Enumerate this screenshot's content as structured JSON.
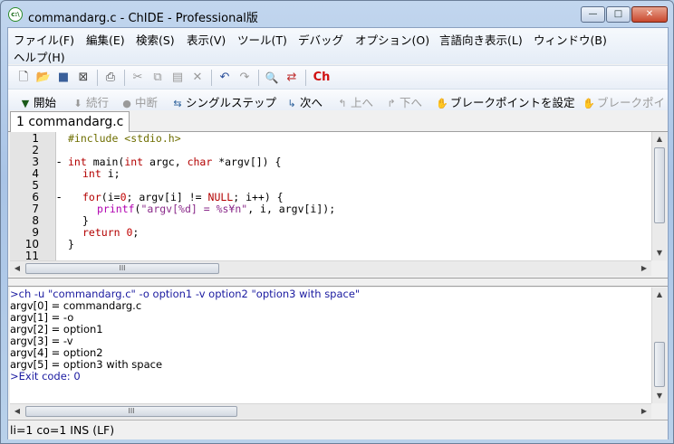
{
  "window": {
    "title": "commandarg.c - ChIDE - Professional版",
    "icon_label": "c:\\",
    "controls": {
      "minimize": "—",
      "maximize": "□",
      "close": "✕"
    }
  },
  "menu": [
    "ファイル(F)",
    "編集(E)",
    "検索(S)",
    "表示(V)",
    "ツール(T)",
    "デバッグ",
    "オプション(O)",
    "言語向き表示(L)",
    "ウィンドウ(B)",
    "ヘルプ(H)"
  ],
  "toolbar_icons": [
    "new-file-icon",
    "open-folder-icon",
    "save-icon",
    "close-file-icon",
    "print-icon",
    "cut-icon",
    "copy-icon",
    "paste-icon",
    "delete-icon",
    "undo-icon",
    "redo-icon",
    "find-icon",
    "replace-icon",
    "ch-run-icon"
  ],
  "toolbar_glyphs": {
    "new": "🗋",
    "open": "📂",
    "save": "■",
    "closefile": "⊠",
    "print": "⎙",
    "cut": "✂",
    "copy": "⧉",
    "paste": "▤",
    "delete": "✕",
    "undo": "↶",
    "redo": "↷",
    "find": "🔍",
    "replace": "⇄",
    "ch": "Ch"
  },
  "debug": {
    "start": "開始",
    "continue": "続行",
    "abort": "中断",
    "single_step": "シングルステップ",
    "next": "次へ",
    "up": "上へ",
    "down": "下へ",
    "breakpoint": "ブレークポイントを設定",
    "breakpoint2": "ブレークポイ"
  },
  "tab": {
    "label": "1 commandarg.c"
  },
  "editor": {
    "line_numbers": [
      "1",
      "2",
      "3",
      "4",
      "5",
      "6",
      "7",
      "8",
      "9",
      "10",
      "11"
    ],
    "lines": {
      "l1_pp": "#include <stdio.h>",
      "l3_kw1": "int",
      "l3_a": " main(",
      "l3_kw2": "int",
      "l3_b": " argc, ",
      "l3_kw3": "char",
      "l3_c": " *argv[]) {",
      "l4_kw": "int",
      "l4_a": " i;",
      "l6_kw": "for",
      "l6_a": "(i=",
      "l6_n1": "0",
      "l6_b": "; argv[i] != ",
      "l6_null": "NULL",
      "l6_c": "; i++) {",
      "l7_fn": "printf",
      "l7_a": "(",
      "l7_str": "\"argv[%d] = %s¥n\"",
      "l7_b": ", i, argv[i]);",
      "l8": "}",
      "l9_kw": "return",
      "l9_n": " 0",
      "l9_a": ";",
      "l10": "}"
    },
    "fold_marks": [
      "-",
      "-"
    ]
  },
  "output": {
    "lines": [
      ">ch -u \"commandarg.c\" -o option1 -v option2 \"option3 with space\"",
      "argv[0] = commandarg.c",
      "argv[1] = -o",
      "argv[2] = option1",
      "argv[3] = -v",
      "argv[4] = option2",
      "argv[5] = option3 with space",
      ">Exit code: 0"
    ]
  },
  "scroll": {
    "up": "▲",
    "down": "▼",
    "left": "◀",
    "right": "▶",
    "grip": "III"
  },
  "status": {
    "text": "li=1 co=1 INS (LF)"
  }
}
